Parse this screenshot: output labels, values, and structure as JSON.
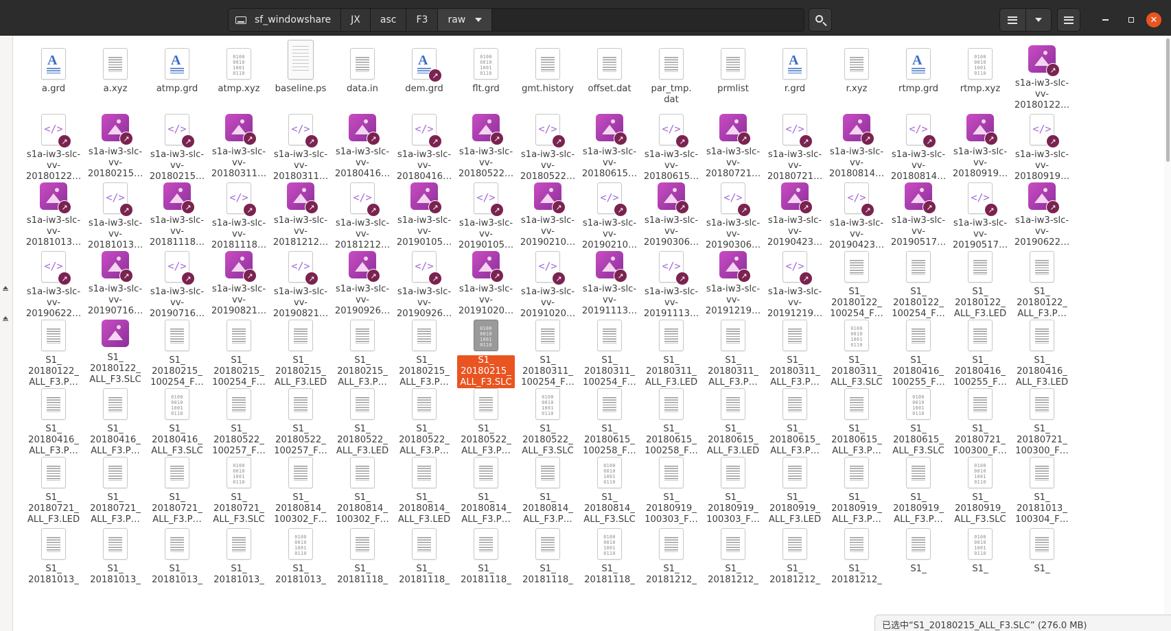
{
  "pathbar": {
    "crumbs": [
      "sf_windowshare",
      "JX",
      "asc",
      "F3",
      "raw"
    ]
  },
  "status": "已选中“S1_20180215_ALL_F3.SLC” (276.0 MB)",
  "files": [
    {
      "name": "a.grd",
      "icon": "grid-doc-icon",
      "type": "gridf"
    },
    {
      "name": "a.xyz",
      "icon": "text-doc-icon",
      "type": "text"
    },
    {
      "name": "atmp.grd",
      "icon": "grid-doc-icon",
      "type": "gridf"
    },
    {
      "name": "atmp.xyz",
      "icon": "binary-doc-icon",
      "type": "bin"
    },
    {
      "name": "baseline.ps",
      "icon": "postscript-doc-icon",
      "type": "ps"
    },
    {
      "name": "data.in",
      "icon": "text-doc-icon",
      "type": "text"
    },
    {
      "name": "dem.grd",
      "icon": "grid-doc-icon",
      "type": "gridf",
      "link": true
    },
    {
      "name": "flt.grd",
      "icon": "binary-doc-icon",
      "type": "bin"
    },
    {
      "name": "gmt.history",
      "icon": "text-doc-icon",
      "type": "text"
    },
    {
      "name": "offset.dat",
      "icon": "text-doc-icon",
      "type": "text"
    },
    {
      "name": "par_tmp.\ndat",
      "icon": "text-doc-icon",
      "type": "text"
    },
    {
      "name": "prmlist",
      "icon": "text-doc-icon",
      "type": "text"
    },
    {
      "name": "r.grd",
      "icon": "grid-doc-icon",
      "type": "gridf"
    },
    {
      "name": "r.xyz",
      "icon": "text-doc-icon",
      "type": "text"
    },
    {
      "name": "rtmp.grd",
      "icon": "grid-doc-icon",
      "type": "gridf"
    },
    {
      "name": "rtmp.xyz",
      "icon": "binary-doc-icon",
      "type": "bin"
    },
    {
      "name": "s1a-iw3-slc-\nvv-\n20180122…",
      "icon": "image-icon",
      "type": "img",
      "link": true
    },
    {
      "name": "s1a-iw3-slc-\nvv-\n20180122…",
      "icon": "xml-doc-icon",
      "type": "code",
      "link": true
    },
    {
      "name": "s1a-iw3-slc-\nvv-\n20180215…",
      "icon": "image-icon",
      "type": "img",
      "link": true
    },
    {
      "name": "s1a-iw3-slc-\nvv-\n20180215…",
      "icon": "xml-doc-icon",
      "type": "code",
      "link": true
    },
    {
      "name": "s1a-iw3-slc-\nvv-\n20180311…",
      "icon": "image-icon",
      "type": "img",
      "link": true
    },
    {
      "name": "s1a-iw3-slc-\nvv-\n20180311…",
      "icon": "xml-doc-icon",
      "type": "code",
      "link": true
    },
    {
      "name": "s1a-iw3-slc-\nvv-\n20180416…",
      "icon": "image-icon",
      "type": "img",
      "link": true
    },
    {
      "name": "s1a-iw3-slc-\nvv-\n20180416…",
      "icon": "xml-doc-icon",
      "type": "code",
      "link": true
    },
    {
      "name": "s1a-iw3-slc-\nvv-\n20180522…",
      "icon": "image-icon",
      "type": "img",
      "link": true
    },
    {
      "name": "s1a-iw3-slc-\nvv-\n20180522…",
      "icon": "xml-doc-icon",
      "type": "code",
      "link": true
    },
    {
      "name": "s1a-iw3-slc-\nvv-\n20180615…",
      "icon": "image-icon",
      "type": "img",
      "link": true
    },
    {
      "name": "s1a-iw3-slc-\nvv-\n20180615…",
      "icon": "xml-doc-icon",
      "type": "code",
      "link": true
    },
    {
      "name": "s1a-iw3-slc-\nvv-\n20180721…",
      "icon": "image-icon",
      "type": "img",
      "link": true
    },
    {
      "name": "s1a-iw3-slc-\nvv-\n20180721…",
      "icon": "xml-doc-icon",
      "type": "code",
      "link": true
    },
    {
      "name": "s1a-iw3-slc-\nvv-\n20180814…",
      "icon": "image-icon",
      "type": "img",
      "link": true
    },
    {
      "name": "s1a-iw3-slc-\nvv-\n20180814…",
      "icon": "xml-doc-icon",
      "type": "code",
      "link": true
    },
    {
      "name": "s1a-iw3-slc-\nvv-\n20180919…",
      "icon": "image-icon",
      "type": "img",
      "link": true
    },
    {
      "name": "s1a-iw3-slc-\nvv-\n20180919…",
      "icon": "xml-doc-icon",
      "type": "code",
      "link": true
    },
    {
      "name": "s1a-iw3-slc-\nvv-\n20181013…",
      "icon": "image-icon",
      "type": "img",
      "link": true
    },
    {
      "name": "s1a-iw3-slc-\nvv-\n20181013…",
      "icon": "xml-doc-icon",
      "type": "code",
      "link": true
    },
    {
      "name": "s1a-iw3-slc-\nvv-\n20181118…",
      "icon": "image-icon",
      "type": "img",
      "link": true
    },
    {
      "name": "s1a-iw3-slc-\nvv-\n20181118…",
      "icon": "xml-doc-icon",
      "type": "code",
      "link": true
    },
    {
      "name": "s1a-iw3-slc-\nvv-\n20181212…",
      "icon": "image-icon",
      "type": "img",
      "link": true
    },
    {
      "name": "s1a-iw3-slc-\nvv-\n20181212…",
      "icon": "xml-doc-icon",
      "type": "code",
      "link": true
    },
    {
      "name": "s1a-iw3-slc-\nvv-\n20190105…",
      "icon": "image-icon",
      "type": "img",
      "link": true
    },
    {
      "name": "s1a-iw3-slc-\nvv-\n20190105…",
      "icon": "xml-doc-icon",
      "type": "code",
      "link": true
    },
    {
      "name": "s1a-iw3-slc-\nvv-\n20190210…",
      "icon": "image-icon",
      "type": "img",
      "link": true
    },
    {
      "name": "s1a-iw3-slc-\nvv-\n20190210…",
      "icon": "xml-doc-icon",
      "type": "code",
      "link": true
    },
    {
      "name": "s1a-iw3-slc-\nvv-\n20190306…",
      "icon": "image-icon",
      "type": "img",
      "link": true
    },
    {
      "name": "s1a-iw3-slc-\nvv-\n20190306…",
      "icon": "xml-doc-icon",
      "type": "code",
      "link": true
    },
    {
      "name": "s1a-iw3-slc-\nvv-\n20190423…",
      "icon": "image-icon",
      "type": "img",
      "link": true
    },
    {
      "name": "s1a-iw3-slc-\nvv-\n20190423…",
      "icon": "xml-doc-icon",
      "type": "code",
      "link": true
    },
    {
      "name": "s1a-iw3-slc-\nvv-\n20190517…",
      "icon": "image-icon",
      "type": "img",
      "link": true
    },
    {
      "name": "s1a-iw3-slc-\nvv-\n20190517…",
      "icon": "xml-doc-icon",
      "type": "code",
      "link": true
    },
    {
      "name": "s1a-iw3-slc-\nvv-\n20190622…",
      "icon": "image-icon",
      "type": "img",
      "link": true
    },
    {
      "name": "s1a-iw3-slc-\nvv-\n20190622…",
      "icon": "xml-doc-icon",
      "type": "code",
      "link": true
    },
    {
      "name": "s1a-iw3-slc-\nvv-\n20190716…",
      "icon": "image-icon",
      "type": "img",
      "link": true
    },
    {
      "name": "s1a-iw3-slc-\nvv-\n20190716…",
      "icon": "xml-doc-icon",
      "type": "code",
      "link": true
    },
    {
      "name": "s1a-iw3-slc-\nvv-\n20190821…",
      "icon": "image-icon",
      "type": "img",
      "link": true
    },
    {
      "name": "s1a-iw3-slc-\nvv-\n20190821…",
      "icon": "xml-doc-icon",
      "type": "code",
      "link": true
    },
    {
      "name": "s1a-iw3-slc-\nvv-\n20190926…",
      "icon": "image-icon",
      "type": "img",
      "link": true
    },
    {
      "name": "s1a-iw3-slc-\nvv-\n20190926…",
      "icon": "xml-doc-icon",
      "type": "code",
      "link": true
    },
    {
      "name": "s1a-iw3-slc-\nvv-\n20191020…",
      "icon": "image-icon",
      "type": "img",
      "link": true
    },
    {
      "name": "s1a-iw3-slc-\nvv-\n20191020…",
      "icon": "xml-doc-icon",
      "type": "code",
      "link": true
    },
    {
      "name": "s1a-iw3-slc-\nvv-\n20191113…",
      "icon": "image-icon",
      "type": "img",
      "link": true
    },
    {
      "name": "s1a-iw3-slc-\nvv-\n20191113…",
      "icon": "xml-doc-icon",
      "type": "code",
      "link": true
    },
    {
      "name": "s1a-iw3-slc-\nvv-\n20191219…",
      "icon": "image-icon",
      "type": "img",
      "link": true
    },
    {
      "name": "s1a-iw3-slc-\nvv-\n20191219…",
      "icon": "xml-doc-icon",
      "type": "code",
      "link": true
    },
    {
      "name": "S1_\n20180122_\n100254_F…",
      "icon": "text-doc-icon",
      "type": "text"
    },
    {
      "name": "S1_\n20180122_\n100254_F…",
      "icon": "text-doc-icon",
      "type": "text"
    },
    {
      "name": "S1_\n20180122_\nALL_F3.LED",
      "icon": "text-doc-icon",
      "type": "text"
    },
    {
      "name": "S1_\n20180122_\nALL_F3.P…",
      "icon": "text-doc-icon",
      "type": "text"
    },
    {
      "name": "S1_\n20180122_\nALL_F3.P…",
      "icon": "text-doc-icon",
      "type": "text"
    },
    {
      "name": "S1_\n20180122_\nALL_F3.SLC",
      "icon": "image-icon",
      "type": "img"
    },
    {
      "name": "S1_\n20180215_\n100254_F…",
      "icon": "text-doc-icon",
      "type": "text"
    },
    {
      "name": "S1_\n20180215_\n100254_F…",
      "icon": "text-doc-icon",
      "type": "text"
    },
    {
      "name": "S1_\n20180215_\nALL_F3.LED",
      "icon": "text-doc-icon",
      "type": "text"
    },
    {
      "name": "S1_\n20180215_\nALL_F3.P…",
      "icon": "text-doc-icon",
      "type": "text"
    },
    {
      "name": "S1_\n20180215_\nALL_F3.P…",
      "icon": "text-doc-icon",
      "type": "text"
    },
    {
      "name": "S1_\n20180215_\nALL_F3.SLC",
      "icon": "binary-doc-icon",
      "type": "bin",
      "selected": true
    },
    {
      "name": "S1_\n20180311_\n100254_F…",
      "icon": "text-doc-icon",
      "type": "text"
    },
    {
      "name": "S1_\n20180311_\n100254_F…",
      "icon": "text-doc-icon",
      "type": "text"
    },
    {
      "name": "S1_\n20180311_\nALL_F3.LED",
      "icon": "text-doc-icon",
      "type": "text"
    },
    {
      "name": "S1_\n20180311_\nALL_F3.P…",
      "icon": "text-doc-icon",
      "type": "text"
    },
    {
      "name": "S1_\n20180311_\nALL_F3.P…",
      "icon": "text-doc-icon",
      "type": "text"
    },
    {
      "name": "S1_\n20180311_\nALL_F3.SLC",
      "icon": "binary-doc-icon",
      "type": "bin"
    },
    {
      "name": "S1_\n20180416_\n100255_F…",
      "icon": "text-doc-icon",
      "type": "text"
    },
    {
      "name": "S1_\n20180416_\n100255_F…",
      "icon": "text-doc-icon",
      "type": "text"
    },
    {
      "name": "S1_\n20180416_\nALL_F3.LED",
      "icon": "text-doc-icon",
      "type": "text"
    },
    {
      "name": "S1_\n20180416_\nALL_F3.P…",
      "icon": "text-doc-icon",
      "type": "text"
    },
    {
      "name": "S1_\n20180416_\nALL_F3.P…",
      "icon": "text-doc-icon",
      "type": "text"
    },
    {
      "name": "S1_\n20180416_\nALL_F3.SLC",
      "icon": "binary-doc-icon",
      "type": "bin"
    },
    {
      "name": "S1_\n20180522_\n100257_F…",
      "icon": "text-doc-icon",
      "type": "text"
    },
    {
      "name": "S1_\n20180522_\n100257_F…",
      "icon": "text-doc-icon",
      "type": "text"
    },
    {
      "name": "S1_\n20180522_\nALL_F3.LED",
      "icon": "text-doc-icon",
      "type": "text"
    },
    {
      "name": "S1_\n20180522_\nALL_F3.P…",
      "icon": "text-doc-icon",
      "type": "text"
    },
    {
      "name": "S1_\n20180522_\nALL_F3.P…",
      "icon": "text-doc-icon",
      "type": "text"
    },
    {
      "name": "S1_\n20180522_\nALL_F3.SLC",
      "icon": "binary-doc-icon",
      "type": "bin"
    },
    {
      "name": "S1_\n20180615_\n100258_F…",
      "icon": "text-doc-icon",
      "type": "text"
    },
    {
      "name": "S1_\n20180615_\n100258_F…",
      "icon": "text-doc-icon",
      "type": "text"
    },
    {
      "name": "S1_\n20180615_\nALL_F3.LED",
      "icon": "text-doc-icon",
      "type": "text"
    },
    {
      "name": "S1_\n20180615_\nALL_F3.P…",
      "icon": "text-doc-icon",
      "type": "text"
    },
    {
      "name": "S1_\n20180615_\nALL_F3.P…",
      "icon": "text-doc-icon",
      "type": "text"
    },
    {
      "name": "S1_\n20180615_\nALL_F3.SLC",
      "icon": "binary-doc-icon",
      "type": "bin"
    },
    {
      "name": "S1_\n20180721_\n100300_F…",
      "icon": "text-doc-icon",
      "type": "text"
    },
    {
      "name": "S1_\n20180721_\n100300_F…",
      "icon": "text-doc-icon",
      "type": "text"
    },
    {
      "name": "S1_\n20180721_\nALL_F3.LED",
      "icon": "text-doc-icon",
      "type": "text"
    },
    {
      "name": "S1_\n20180721_\nALL_F3.P…",
      "icon": "text-doc-icon",
      "type": "text"
    },
    {
      "name": "S1_\n20180721_\nALL_F3.P…",
      "icon": "text-doc-icon",
      "type": "text"
    },
    {
      "name": "S1_\n20180721_\nALL_F3.SLC",
      "icon": "binary-doc-icon",
      "type": "bin"
    },
    {
      "name": "S1_\n20180814_\n100302_F…",
      "icon": "text-doc-icon",
      "type": "text"
    },
    {
      "name": "S1_\n20180814_\n100302_F…",
      "icon": "text-doc-icon",
      "type": "text"
    },
    {
      "name": "S1_\n20180814_\nALL_F3.LED",
      "icon": "text-doc-icon",
      "type": "text"
    },
    {
      "name": "S1_\n20180814_\nALL_F3.P…",
      "icon": "text-doc-icon",
      "type": "text"
    },
    {
      "name": "S1_\n20180814_\nALL_F3.P…",
      "icon": "text-doc-icon",
      "type": "text"
    },
    {
      "name": "S1_\n20180814_\nALL_F3.SLC",
      "icon": "binary-doc-icon",
      "type": "bin"
    },
    {
      "name": "S1_\n20180919_\n100303_F…",
      "icon": "text-doc-icon",
      "type": "text"
    },
    {
      "name": "S1_\n20180919_\n100303_F…",
      "icon": "text-doc-icon",
      "type": "text"
    },
    {
      "name": "S1_\n20180919_\nALL_F3.LED",
      "icon": "text-doc-icon",
      "type": "text"
    },
    {
      "name": "S1_\n20180919_\nALL_F3.P…",
      "icon": "text-doc-icon",
      "type": "text"
    },
    {
      "name": "S1_\n20180919_\nALL_F3.P…",
      "icon": "text-doc-icon",
      "type": "text"
    },
    {
      "name": "S1_\n20180919_\nALL_F3.SLC",
      "icon": "binary-doc-icon",
      "type": "bin"
    },
    {
      "name": "S1_\n20181013_\n100304_F…",
      "icon": "text-doc-icon",
      "type": "text"
    },
    {
      "name": "S1_\n20181013_",
      "icon": "text-doc-icon",
      "type": "text"
    },
    {
      "name": "S1_\n20181013_",
      "icon": "text-doc-icon",
      "type": "text"
    },
    {
      "name": "S1_\n20181013_",
      "icon": "text-doc-icon",
      "type": "text"
    },
    {
      "name": "S1_\n20181013_",
      "icon": "text-doc-icon",
      "type": "text"
    },
    {
      "name": "S1_\n20181013_",
      "icon": "binary-doc-icon",
      "type": "bin"
    },
    {
      "name": "S1_\n20181118_",
      "icon": "text-doc-icon",
      "type": "text"
    },
    {
      "name": "S1_\n20181118_",
      "icon": "text-doc-icon",
      "type": "text"
    },
    {
      "name": "S1_\n20181118_",
      "icon": "text-doc-icon",
      "type": "text"
    },
    {
      "name": "S1_\n20181118_",
      "icon": "text-doc-icon",
      "type": "text"
    },
    {
      "name": "S1_\n20181118_",
      "icon": "binary-doc-icon",
      "type": "bin"
    },
    {
      "name": "S1_\n20181212_",
      "icon": "text-doc-icon",
      "type": "text"
    },
    {
      "name": "S1_\n20181212_",
      "icon": "text-doc-icon",
      "type": "text"
    },
    {
      "name": "S1_\n20181212_",
      "icon": "text-doc-icon",
      "type": "text"
    },
    {
      "name": "S1_\n20181212_",
      "icon": "text-doc-icon",
      "type": "text"
    },
    {
      "name": "S1_",
      "icon": "text-doc-icon",
      "type": "text"
    },
    {
      "name": "S1_",
      "icon": "binary-doc-icon",
      "type": "bin"
    },
    {
      "name": "S1_",
      "icon": "text-doc-icon",
      "type": "text"
    }
  ],
  "colors": {
    "header_bg": "#2c2c2c",
    "selection": "#e95420",
    "image_icon": "#b23fb6",
    "grid_icon": "#3a6ec6"
  }
}
